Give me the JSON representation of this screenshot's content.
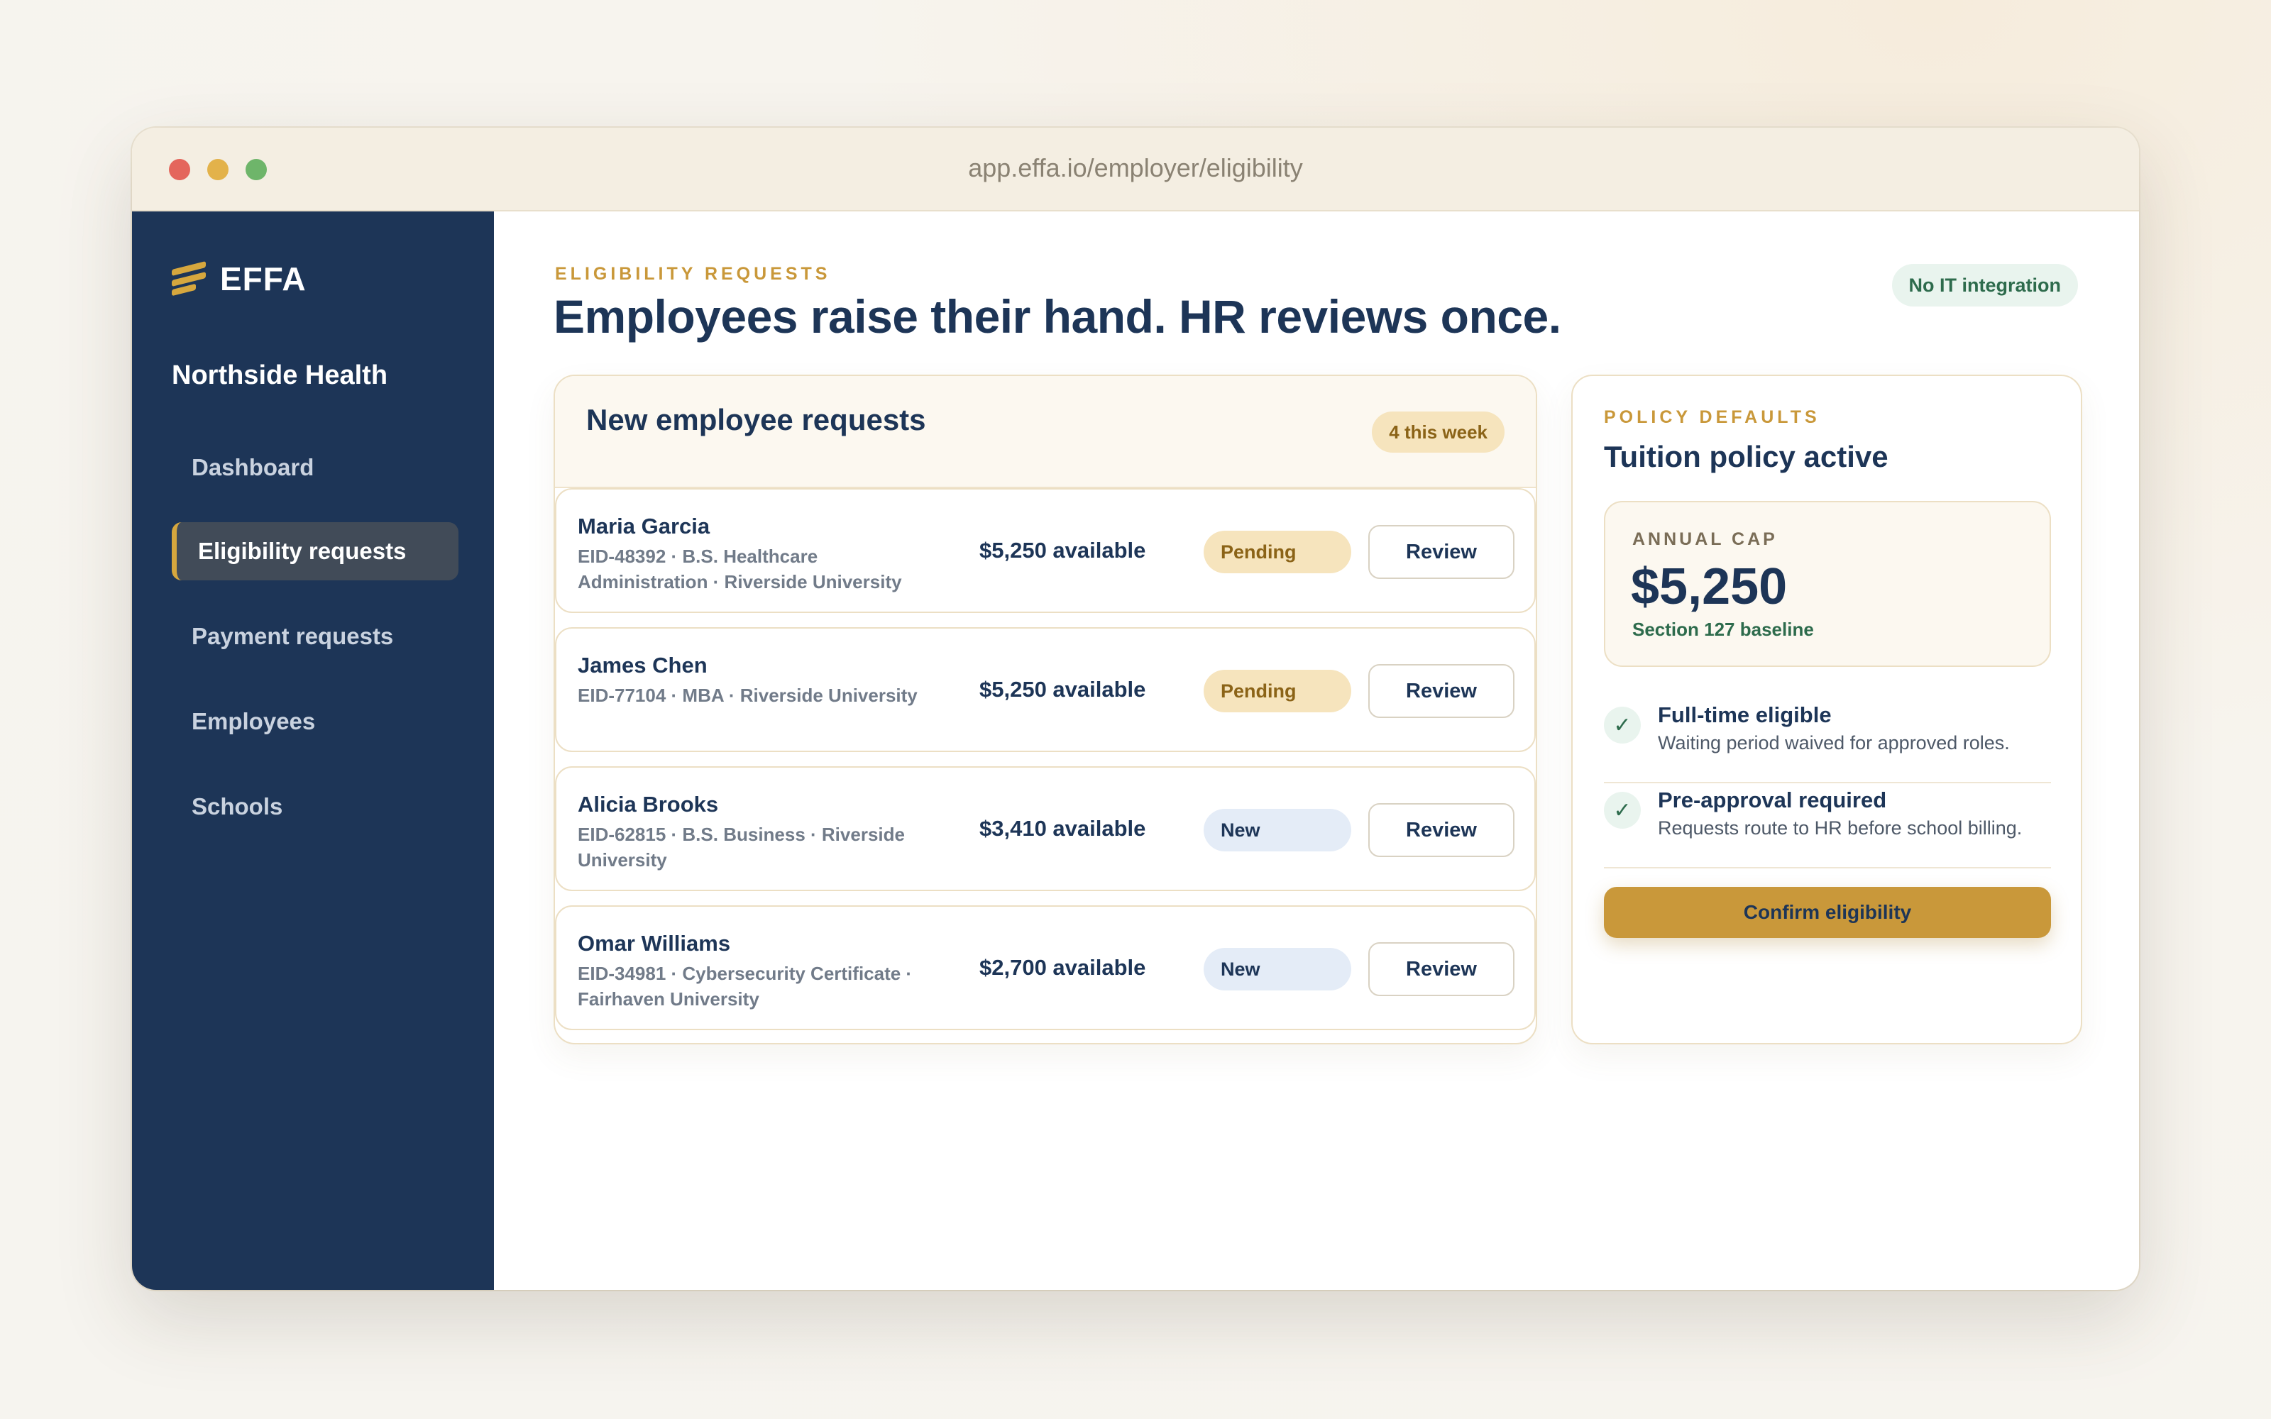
{
  "window": {
    "url": "app.effa.io/employer/eligibility"
  },
  "sidebar": {
    "logo": "EFFA",
    "org_name": "Northside Health",
    "items": [
      {
        "label": "Dashboard"
      },
      {
        "label": "Eligibility requests",
        "active": true
      },
      {
        "label": "Payment requests"
      },
      {
        "label": "Employees"
      },
      {
        "label": "Schools"
      }
    ]
  },
  "header": {
    "eyebrow": "ELIGIBILITY REQUESTS",
    "title": "Employees raise their hand. HR reviews once.",
    "badge": "No IT integration"
  },
  "requests": {
    "title": "New employee requests",
    "count_badge": "4 this week",
    "rows": [
      {
        "name": "Maria Garcia",
        "meta": "EID-48392 · B.S. Healthcare Administration · Riverside University",
        "amount": "$5,250 available",
        "status": "Pending",
        "action": "Review"
      },
      {
        "name": "James Chen",
        "meta": "EID-77104 · MBA · Riverside University",
        "amount": "$5,250 available",
        "status": "Pending",
        "action": "Review"
      },
      {
        "name": "Alicia Brooks",
        "meta": "EID-62815 · B.S. Business · Riverside University",
        "amount": "$3,410 available",
        "status": "New",
        "action": "Review"
      },
      {
        "name": "Omar Williams",
        "meta": "EID-34981 · Cybersecurity Certificate · Fairhaven University",
        "amount": "$2,700 available",
        "status": "New",
        "action": "Review"
      }
    ]
  },
  "policy": {
    "eyebrow": "POLICY DEFAULTS",
    "title": "Tuition policy active",
    "cap_label": "ANNUAL CAP",
    "cap_value": "$5,250",
    "cap_sub": "Section 127 baseline",
    "checks": [
      {
        "title": "Full-time eligible",
        "desc": "Waiting period waived for approved roles."
      },
      {
        "title": "Pre-approval required",
        "desc": "Requests route to HR before school billing."
      }
    ],
    "confirm_label": "Confirm eligibility"
  },
  "colors": {
    "navy": "#1d3557",
    "gold": "#c9983a",
    "green": "#2d6b4c",
    "pending_bg": "#f6e4bd",
    "new_bg": "#e4ecf7"
  }
}
